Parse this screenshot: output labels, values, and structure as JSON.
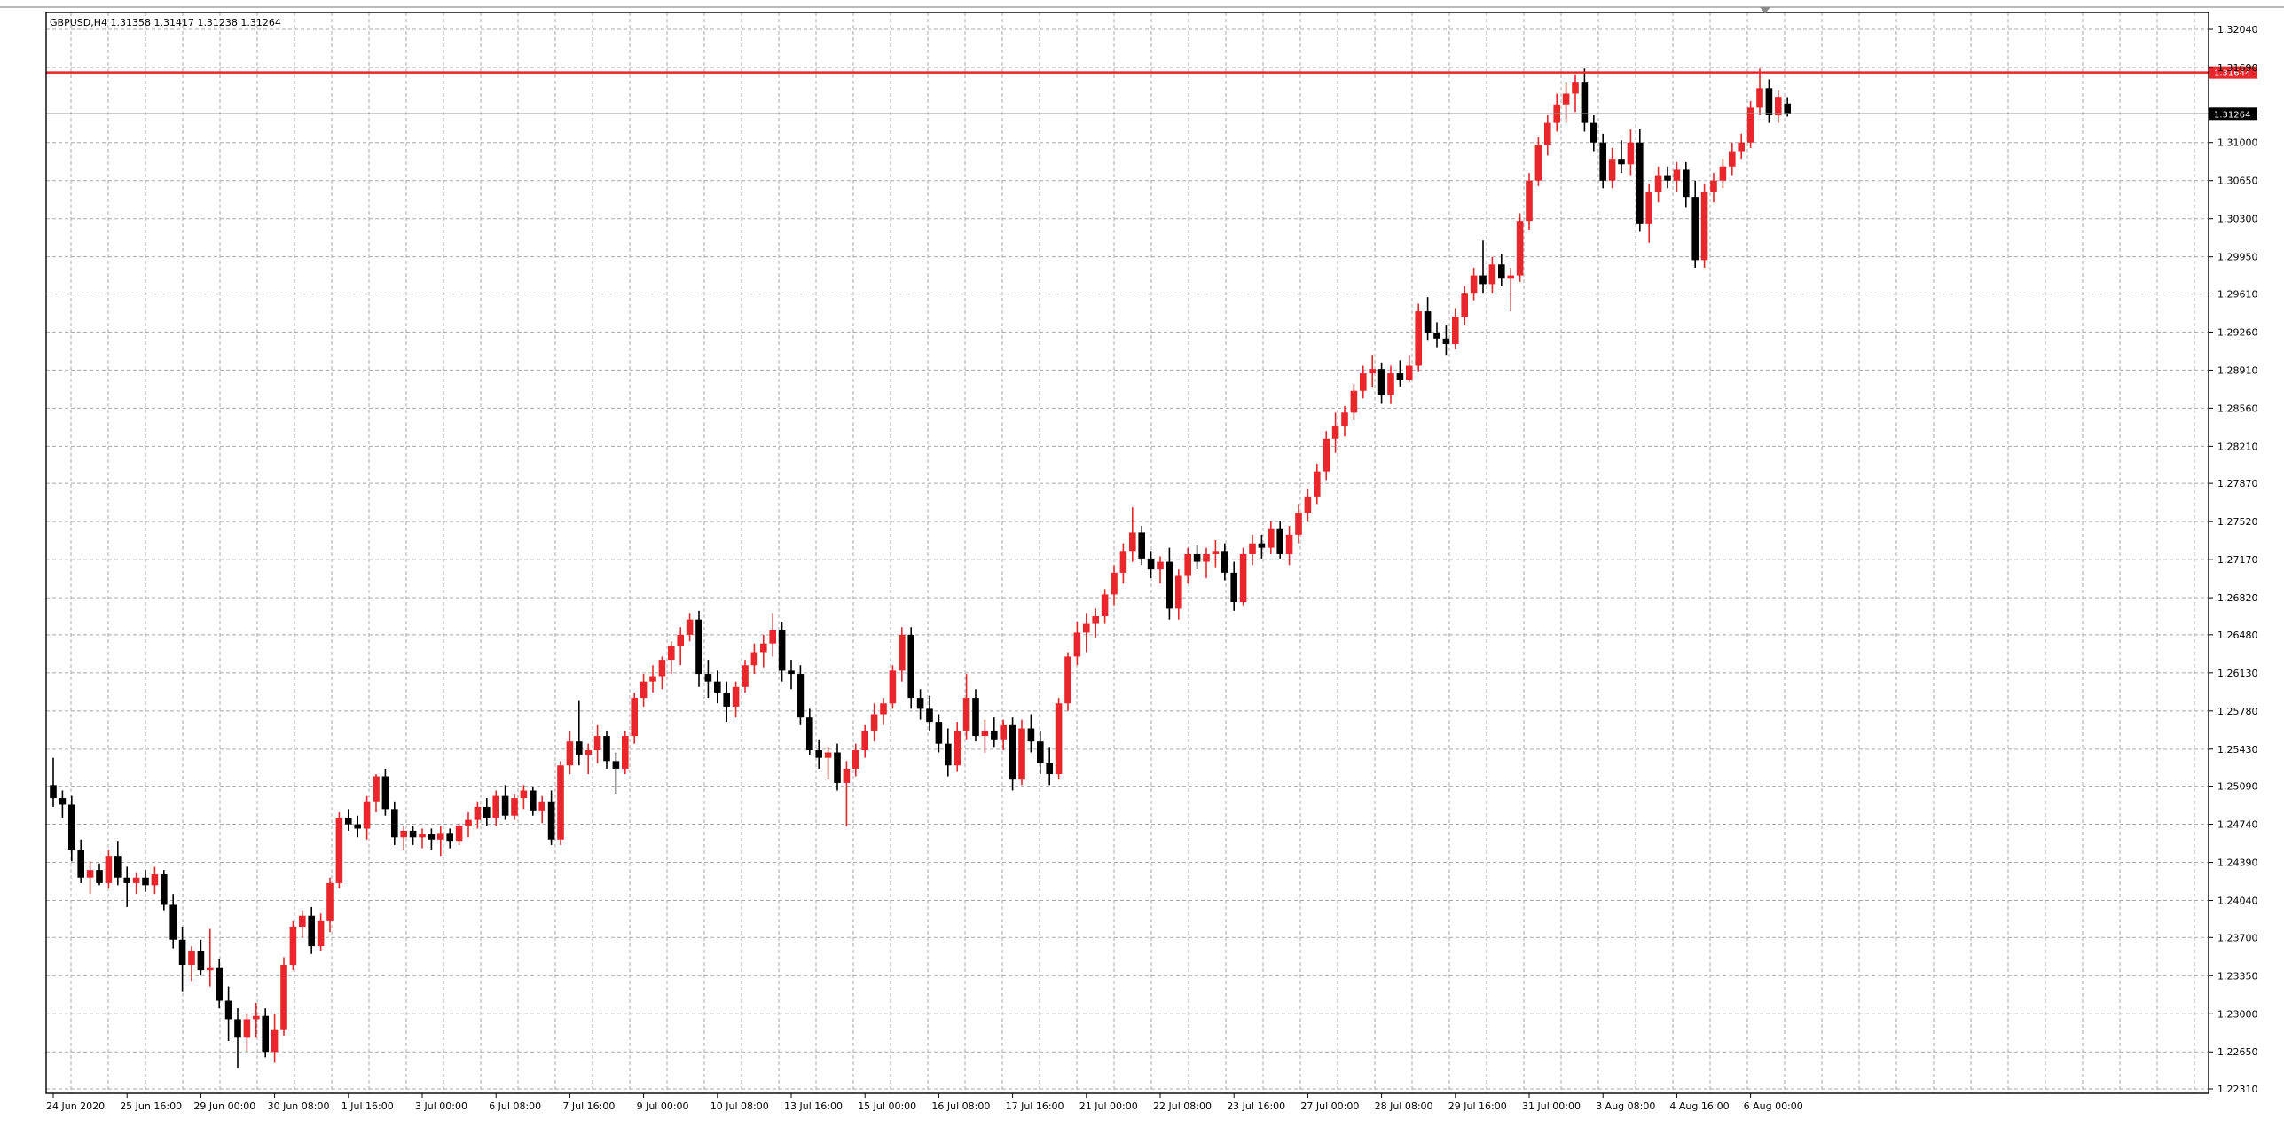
{
  "header": {
    "info_line": "GBPUSD,H4  1.31358 1.31417 1.31238 1.31264"
  },
  "colors": {
    "bull": "#e8262b",
    "bear": "#000000",
    "grid": "#a8a8a8",
    "resistance_line": "#e8262b",
    "current_price_line": "#9a9a9a",
    "current_price_badge": "#000000"
  },
  "chart_data": {
    "type": "candlestick",
    "symbol": "GBPUSD",
    "timeframe": "H4",
    "header_ohlc": {
      "open": 1.31358,
      "high": 1.31417,
      "low": 1.31238,
      "close": 1.31264
    },
    "ylim": [
      1.2231,
      1.3204
    ],
    "y_ticks": [
      "1.32040",
      "1.31690",
      "1.31000",
      "1.30650",
      "1.30300",
      "1.29950",
      "1.29610",
      "1.29260",
      "1.28910",
      "1.28560",
      "1.28210",
      "1.27870",
      "1.27520",
      "1.27170",
      "1.26820",
      "1.26480",
      "1.26130",
      "1.25780",
      "1.25430",
      "1.25090",
      "1.24740",
      "1.24390",
      "1.24040",
      "1.23700",
      "1.23350",
      "1.23000",
      "1.22650",
      "1.22310"
    ],
    "x_ticks": [
      "24 Jun 2020",
      "25 Jun 16:00",
      "29 Jun 00:00",
      "30 Jun 08:00",
      "1 Jul 16:00",
      "3 Jul 00:00",
      "6 Jul 08:00",
      "7 Jul 16:00",
      "9 Jul 00:00",
      "10 Jul 08:00",
      "13 Jul 16:00",
      "15 Jul 00:00",
      "16 Jul 08:00",
      "17 Jul 16:00",
      "21 Jul 00:00",
      "22 Jul 08:00",
      "23 Jul 16:00",
      "27 Jul 00:00",
      "28 Jul 08:00",
      "29 Jul 16:00",
      "31 Jul 00:00",
      "3 Aug 08:00",
      "4 Aug 16:00",
      "6 Aug 00:00"
    ],
    "bars_per_tick": 8,
    "horizontal_lines": [
      {
        "price": 1.31644,
        "label": "1.31644",
        "role": "resistance"
      },
      {
        "price": 1.31264,
        "label": "1.31264",
        "role": "current"
      }
    ],
    "grid": true,
    "candles": [
      [
        1.251,
        1.2535,
        1.249,
        1.2498
      ],
      [
        1.2498,
        1.2505,
        1.248,
        1.2492
      ],
      [
        1.2492,
        1.25,
        1.244,
        1.245
      ],
      [
        1.245,
        1.246,
        1.242,
        1.2425
      ],
      [
        1.2425,
        1.244,
        1.241,
        1.2432
      ],
      [
        1.2432,
        1.2438,
        1.2418,
        1.242
      ],
      [
        1.242,
        1.245,
        1.2415,
        1.2445
      ],
      [
        1.2445,
        1.2458,
        1.2418,
        1.2425
      ],
      [
        1.2425,
        1.2435,
        1.2398,
        1.242
      ],
      [
        1.242,
        1.243,
        1.241,
        1.2425
      ],
      [
        1.2425,
        1.2432,
        1.2412,
        1.2418
      ],
      [
        1.2418,
        1.2435,
        1.241,
        1.2428
      ],
      [
        1.2428,
        1.2432,
        1.2395,
        1.24
      ],
      [
        1.24,
        1.241,
        1.236,
        1.2368
      ],
      [
        1.2368,
        1.238,
        1.232,
        1.2345
      ],
      [
        1.2345,
        1.2362,
        1.233,
        1.2358
      ],
      [
        1.2358,
        1.2368,
        1.2335,
        1.234
      ],
      [
        1.234,
        1.2378,
        1.2325,
        1.2342
      ],
      [
        1.2342,
        1.235,
        1.2305,
        1.2312
      ],
      [
        1.2312,
        1.2325,
        1.2275,
        1.2295
      ],
      [
        1.2295,
        1.2305,
        1.225,
        1.2278
      ],
      [
        1.2278,
        1.23,
        1.2265,
        1.2295
      ],
      [
        1.2295,
        1.231,
        1.2278,
        1.2298
      ],
      [
        1.2298,
        1.2305,
        1.226,
        1.2265
      ],
      [
        1.2265,
        1.23,
        1.2255,
        1.2285
      ],
      [
        1.2285,
        1.2352,
        1.228,
        1.2345
      ],
      [
        1.2345,
        1.2385,
        1.234,
        1.238
      ],
      [
        1.238,
        1.2395,
        1.237,
        1.239
      ],
      [
        1.239,
        1.2398,
        1.2355,
        1.2362
      ],
      [
        1.2362,
        1.2392,
        1.2358,
        1.2385
      ],
      [
        1.2385,
        1.2425,
        1.2375,
        1.242
      ],
      [
        1.242,
        1.2485,
        1.2415,
        1.248
      ],
      [
        1.248,
        1.2488,
        1.2468,
        1.2474
      ],
      [
        1.2474,
        1.2482,
        1.2462,
        1.247
      ],
      [
        1.247,
        1.25,
        1.246,
        1.2495
      ],
      [
        1.2495,
        1.252,
        1.2485,
        1.2518
      ],
      [
        1.2518,
        1.2525,
        1.2482,
        1.2488
      ],
      [
        1.2488,
        1.2495,
        1.2455,
        1.2462
      ],
      [
        1.2462,
        1.2472,
        1.245,
        1.2468
      ],
      [
        1.2468,
        1.2472,
        1.2455,
        1.2462
      ],
      [
        1.2462,
        1.247,
        1.2452,
        1.2465
      ],
      [
        1.2465,
        1.247,
        1.245,
        1.246
      ],
      [
        1.246,
        1.2472,
        1.2445,
        1.2466
      ],
      [
        1.2466,
        1.247,
        1.2452,
        1.2458
      ],
      [
        1.2458,
        1.2475,
        1.2455,
        1.2472
      ],
      [
        1.2472,
        1.2485,
        1.2462,
        1.2478
      ],
      [
        1.2478,
        1.2495,
        1.247,
        1.249
      ],
      [
        1.249,
        1.2498,
        1.2472,
        1.248
      ],
      [
        1.248,
        1.2505,
        1.2472,
        1.25
      ],
      [
        1.25,
        1.251,
        1.2478,
        1.2482
      ],
      [
        1.2482,
        1.2502,
        1.2478,
        1.2498
      ],
      [
        1.2498,
        1.251,
        1.2488,
        1.2505
      ],
      [
        1.2505,
        1.2508,
        1.2482,
        1.2486
      ],
      [
        1.2486,
        1.25,
        1.2475,
        1.2495
      ],
      [
        1.2495,
        1.2505,
        1.2455,
        1.246
      ],
      [
        1.246,
        1.2532,
        1.2455,
        1.2528
      ],
      [
        1.2528,
        1.256,
        1.252,
        1.255
      ],
      [
        1.255,
        1.2588,
        1.2528,
        1.2538
      ],
      [
        1.2538,
        1.2548,
        1.252,
        1.2542
      ],
      [
        1.2542,
        1.2565,
        1.253,
        1.2555
      ],
      [
        1.2555,
        1.256,
        1.2525,
        1.2532
      ],
      [
        1.2532,
        1.254,
        1.2502,
        1.2525
      ],
      [
        1.2525,
        1.256,
        1.252,
        1.2555
      ],
      [
        1.2555,
        1.2595,
        1.2548,
        1.259
      ],
      [
        1.259,
        1.2612,
        1.2582,
        1.2605
      ],
      [
        1.2605,
        1.262,
        1.2595,
        1.261
      ],
      [
        1.261,
        1.2628,
        1.2598,
        1.2625
      ],
      [
        1.2625,
        1.2642,
        1.2612,
        1.2638
      ],
      [
        1.2638,
        1.2655,
        1.262,
        1.2648
      ],
      [
        1.2648,
        1.2668,
        1.2642,
        1.2662
      ],
      [
        1.2662,
        1.267,
        1.26,
        1.2612
      ],
      [
        1.2612,
        1.2625,
        1.259,
        1.2605
      ],
      [
        1.2605,
        1.2615,
        1.2585,
        1.2595
      ],
      [
        1.2595,
        1.2605,
        1.2568,
        1.2582
      ],
      [
        1.2582,
        1.2605,
        1.2572,
        1.26
      ],
      [
        1.26,
        1.2625,
        1.2595,
        1.262
      ],
      [
        1.262,
        1.264,
        1.2612,
        1.2632
      ],
      [
        1.2632,
        1.2648,
        1.2618,
        1.264
      ],
      [
        1.264,
        1.2668,
        1.2628,
        1.2652
      ],
      [
        1.2652,
        1.266,
        1.2605,
        1.2615
      ],
      [
        1.2615,
        1.2625,
        1.2598,
        1.2612
      ],
      [
        1.2612,
        1.262,
        1.2565,
        1.2572
      ],
      [
        1.2572,
        1.258,
        1.2538,
        1.2542
      ],
      [
        1.2542,
        1.2552,
        1.2525,
        1.2535
      ],
      [
        1.2535,
        1.2545,
        1.2515,
        1.254
      ],
      [
        1.254,
        1.2548,
        1.2505,
        1.2512
      ],
      [
        1.2512,
        1.2532,
        1.2472,
        1.2525
      ],
      [
        1.2525,
        1.2548,
        1.2518,
        1.2542
      ],
      [
        1.2542,
        1.2565,
        1.2535,
        1.256
      ],
      [
        1.256,
        1.2585,
        1.255,
        1.2575
      ],
      [
        1.2575,
        1.259,
        1.2565,
        1.2585
      ],
      [
        1.2585,
        1.262,
        1.258,
        1.2615
      ],
      [
        1.2615,
        1.2655,
        1.2605,
        1.2648
      ],
      [
        1.2648,
        1.2655,
        1.258,
        1.259
      ],
      [
        1.259,
        1.2598,
        1.257,
        1.258
      ],
      [
        1.258,
        1.2592,
        1.256,
        1.2568
      ],
      [
        1.2568,
        1.2575,
        1.254,
        1.2548
      ],
      [
        1.2548,
        1.2562,
        1.2518,
        1.2528
      ],
      [
        1.2528,
        1.2568,
        1.2522,
        1.256
      ],
      [
        1.256,
        1.2612,
        1.2552,
        1.259
      ],
      [
        1.259,
        1.2598,
        1.255,
        1.2555
      ],
      [
        1.2555,
        1.257,
        1.254,
        1.256
      ],
      [
        1.256,
        1.2572,
        1.2545,
        1.2552
      ],
      [
        1.2552,
        1.257,
        1.2542,
        1.2565
      ],
      [
        1.2565,
        1.2572,
        1.2505,
        1.2515
      ],
      [
        1.2515,
        1.257,
        1.251,
        1.2562
      ],
      [
        1.2562,
        1.2575,
        1.254,
        1.255
      ],
      [
        1.255,
        1.256,
        1.252,
        1.253
      ],
      [
        1.253,
        1.2545,
        1.251,
        1.252
      ],
      [
        1.252,
        1.259,
        1.2515,
        1.2585
      ],
      [
        1.2585,
        1.2632,
        1.2578,
        1.2628
      ],
      [
        1.2628,
        1.266,
        1.262,
        1.265
      ],
      [
        1.265,
        1.2668,
        1.2632,
        1.2658
      ],
      [
        1.2658,
        1.2672,
        1.2645,
        1.2665
      ],
      [
        1.2665,
        1.269,
        1.2658,
        1.2685
      ],
      [
        1.2685,
        1.2712,
        1.2675,
        1.2705
      ],
      [
        1.2705,
        1.2732,
        1.2695,
        1.2725
      ],
      [
        1.2725,
        1.2765,
        1.2715,
        1.2742
      ],
      [
        1.2742,
        1.2748,
        1.2712,
        1.2718
      ],
      [
        1.2718,
        1.2725,
        1.27,
        1.2708
      ],
      [
        1.2708,
        1.272,
        1.2695,
        1.2715
      ],
      [
        1.2715,
        1.2728,
        1.2662,
        1.2672
      ],
      [
        1.2672,
        1.2708,
        1.2662,
        1.2702
      ],
      [
        1.2702,
        1.2728,
        1.2695,
        1.2722
      ],
      [
        1.2722,
        1.273,
        1.2708,
        1.2715
      ],
      [
        1.2715,
        1.2728,
        1.27,
        1.2722
      ],
      [
        1.2722,
        1.2735,
        1.271,
        1.2725
      ],
      [
        1.2725,
        1.2732,
        1.2698,
        1.2705
      ],
      [
        1.2705,
        1.2715,
        1.267,
        1.2678
      ],
      [
        1.2678,
        1.2728,
        1.2675,
        1.2722
      ],
      [
        1.2722,
        1.274,
        1.2712,
        1.2732
      ],
      [
        1.2732,
        1.274,
        1.2718,
        1.2728
      ],
      [
        1.2728,
        1.2752,
        1.2722,
        1.2745
      ],
      [
        1.2745,
        1.2752,
        1.2718,
        1.2722
      ],
      [
        1.2722,
        1.2748,
        1.2712,
        1.274
      ],
      [
        1.274,
        1.2768,
        1.2732,
        1.276
      ],
      [
        1.276,
        1.2782,
        1.2752,
        1.2775
      ],
      [
        1.2775,
        1.2805,
        1.2768,
        1.2798
      ],
      [
        1.2798,
        1.2835,
        1.279,
        1.2828
      ],
      [
        1.2828,
        1.2852,
        1.2815,
        1.284
      ],
      [
        1.284,
        1.2858,
        1.283,
        1.2852
      ],
      [
        1.2852,
        1.2878,
        1.2845,
        1.2872
      ],
      [
        1.2872,
        1.2895,
        1.2865,
        1.2888
      ],
      [
        1.2888,
        1.2905,
        1.2875,
        1.2892
      ],
      [
        1.2892,
        1.2898,
        1.286,
        1.2868
      ],
      [
        1.2868,
        1.2895,
        1.286,
        1.2888
      ],
      [
        1.2888,
        1.29,
        1.2876,
        1.2882
      ],
      [
        1.2882,
        1.2905,
        1.288,
        1.2895
      ],
      [
        1.2895,
        1.2952,
        1.289,
        1.2945
      ],
      [
        1.2945,
        1.2958,
        1.2918,
        1.2925
      ],
      [
        1.2925,
        1.2935,
        1.2912,
        1.292
      ],
      [
        1.292,
        1.2932,
        1.2905,
        1.2915
      ],
      [
        1.2915,
        1.2948,
        1.291,
        1.294
      ],
      [
        1.294,
        1.2968,
        1.2932,
        1.2962
      ],
      [
        1.2962,
        1.2985,
        1.2955,
        1.2978
      ],
      [
        1.2978,
        1.301,
        1.2962,
        1.297
      ],
      [
        1.297,
        1.2995,
        1.2962,
        1.2988
      ],
      [
        1.2988,
        1.2998,
        1.2968,
        1.2975
      ],
      [
        1.2975,
        1.2985,
        1.2945,
        1.2978
      ],
      [
        1.2978,
        1.3035,
        1.2972,
        1.3028
      ],
      [
        1.3028,
        1.3072,
        1.302,
        1.3065
      ],
      [
        1.3065,
        1.3105,
        1.306,
        1.3098
      ],
      [
        1.3098,
        1.3125,
        1.3088,
        1.3118
      ],
      [
        1.3118,
        1.3145,
        1.311,
        1.3135
      ],
      [
        1.3135,
        1.3155,
        1.3118,
        1.3145
      ],
      [
        1.3145,
        1.3162,
        1.3128,
        1.3155
      ],
      [
        1.3155,
        1.3168,
        1.311,
        1.3118
      ],
      [
        1.3118,
        1.3125,
        1.3092,
        1.31
      ],
      [
        1.31,
        1.3108,
        1.3058,
        1.3065
      ],
      [
        1.3065,
        1.3095,
        1.3058,
        1.3085
      ],
      [
        1.3085,
        1.3102,
        1.3072,
        1.308
      ],
      [
        1.308,
        1.3112,
        1.307,
        1.31
      ],
      [
        1.31,
        1.3112,
        1.3018,
        1.3025
      ],
      [
        1.3025,
        1.3062,
        1.3008,
        1.3055
      ],
      [
        1.3055,
        1.3078,
        1.3045,
        1.307
      ],
      [
        1.307,
        1.3078,
        1.3058,
        1.3065
      ],
      [
        1.3065,
        1.3082,
        1.3055,
        1.3075
      ],
      [
        1.3075,
        1.3082,
        1.304,
        1.305
      ],
      [
        1.305,
        1.3065,
        1.2985,
        1.2992
      ],
      [
        1.2992,
        1.3062,
        1.2985,
        1.3055
      ],
      [
        1.3055,
        1.3072,
        1.3045,
        1.3065
      ],
      [
        1.3065,
        1.3085,
        1.3058,
        1.3078
      ],
      [
        1.3078,
        1.31,
        1.307,
        1.3092
      ],
      [
        1.3092,
        1.3108,
        1.3085,
        1.31
      ],
      [
        1.31,
        1.3138,
        1.3095,
        1.3132
      ],
      [
        1.3132,
        1.3168,
        1.3125,
        1.315
      ],
      [
        1.315,
        1.3158,
        1.3118,
        1.3125
      ],
      [
        1.3125,
        1.3148,
        1.3118,
        1.3142
      ],
      [
        1.31358,
        1.31417,
        1.31238,
        1.31264
      ]
    ]
  }
}
